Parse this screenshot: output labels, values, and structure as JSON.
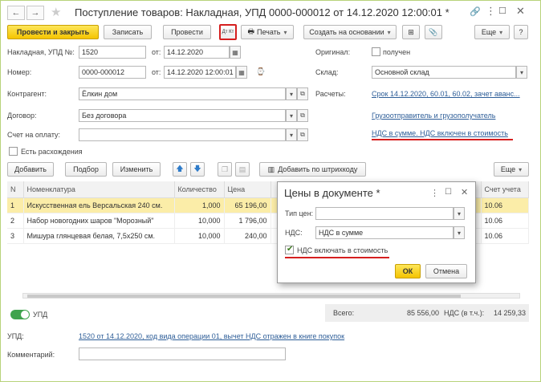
{
  "header": {
    "title": "Поступление товаров: Накладная, УПД 0000-000012 от 14.12.2020 12:00:01 *"
  },
  "toolbar": {
    "post_close": "Провести и закрыть",
    "save": "Записать",
    "post": "Провести",
    "dtkt": "Дт Кт",
    "print": "Печать",
    "create_based": "Создать на основании",
    "more": "Еще"
  },
  "form": {
    "doc_label": "Накладная, УПД №:",
    "doc_number": "1520",
    "ot": "от:",
    "doc_date": "14.12.2020",
    "original_label": "Оригинал:",
    "received": "получен",
    "number_label": "Номер:",
    "number_value": "0000-000012",
    "number_date": "14.12.2020 12:00:01",
    "warehouse_label": "Склад:",
    "warehouse_value": "Основной склад",
    "counterparty_label": "Контрагент:",
    "counterparty_value": "Ёлкин дом",
    "settlements_label": "Расчеты:",
    "settlements_link": "Срок 14.12.2020, 60.01, 60.02, зачет аванс...",
    "contract_label": "Договор:",
    "contract_value": "Без договора",
    "shipper_link": "Грузоотправитель и грузополучатель",
    "invoice_label": "Счет на оплату:",
    "vat_link": "НДС в сумме. НДС включен в стоимость",
    "discrepancy": "Есть расхождения"
  },
  "table_toolbar": {
    "add": "Добавить",
    "pick": "Подбор",
    "change": "Изменить",
    "barcode": "Добавить по штрихкоду",
    "more": "Еще"
  },
  "table": {
    "headers": [
      "N",
      "Номенклатура",
      "Количество",
      "Цена",
      "Счет учета"
    ],
    "rows": [
      {
        "n": "1",
        "name": "Искусственная ель Версальская 240 см.",
        "qty": "1,000",
        "price": "65 196,00",
        "account": "10.06"
      },
      {
        "n": "2",
        "name": "Набор новогодних шаров \"Морозный\"",
        "qty": "10,000",
        "price": "1 796,00",
        "account": "10.06"
      },
      {
        "n": "3",
        "name": "Мишура глянцевая белая, 7,5х250 см.",
        "qty": "10,000",
        "price": "240,00",
        "account": "10.06"
      }
    ]
  },
  "dialog": {
    "title": "Цены в документе *",
    "price_type_label": "Тип цен:",
    "price_type_value": "",
    "vat_label": "НДС:",
    "vat_value": "НДС в сумме",
    "vat_included": "НДС включать в стоимость",
    "ok": "ОК",
    "cancel": "Отмена"
  },
  "footer": {
    "upd_toggle_label": "УПД",
    "total_label": "Всего:",
    "total_value": "85 556,00",
    "vat_total_label": "НДС (в т.ч.):",
    "vat_total_value": "14 259,33",
    "upd_label": "УПД:",
    "upd_link": "1520 от 14.12.2020, код вида операции 01, вычет НДС отражен в книге покупок",
    "comment_label": "Комментарий:"
  },
  "colors": {
    "accent_yellow": "#f5c400",
    "highlight_red": "#d51f1f",
    "link_blue": "#2e5e98",
    "selected_row": "#fbeda8",
    "toggle_green": "#3fa34d"
  }
}
